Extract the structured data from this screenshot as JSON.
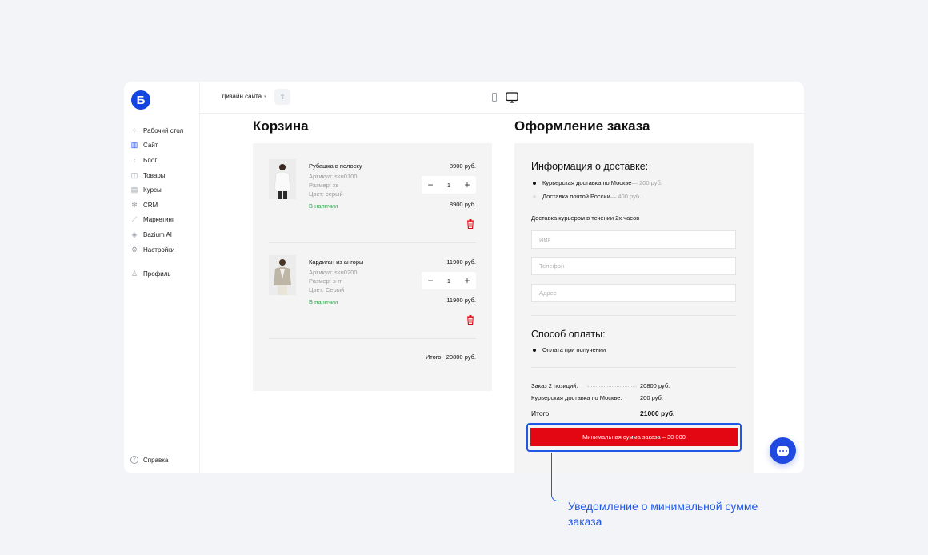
{
  "sidebar": {
    "logo": "Б",
    "items": [
      {
        "label": "Рабочий стол",
        "icon": "grid-icon",
        "glyph": "⁘"
      },
      {
        "label": "Сайт",
        "icon": "layout-icon",
        "glyph": "▥"
      },
      {
        "label": "Блог",
        "icon": "chevron-left-icon",
        "glyph": "‹"
      },
      {
        "label": "Товары",
        "icon": "bag-icon",
        "glyph": "◫"
      },
      {
        "label": "Курсы",
        "icon": "book-icon",
        "glyph": "▤"
      },
      {
        "label": "CRM",
        "icon": "snowflake-icon",
        "glyph": "✻"
      },
      {
        "label": "Маркетинг",
        "icon": "chart-icon",
        "glyph": "⟋"
      },
      {
        "label": "Bazium AI",
        "icon": "ai-icon",
        "glyph": "◈"
      },
      {
        "label": "Настройки",
        "icon": "gear-icon",
        "glyph": "⚙"
      }
    ],
    "profile": {
      "label": "Профиль",
      "icon": "user-icon",
      "glyph": "♙"
    },
    "help": {
      "label": "Справка",
      "glyph": "?"
    }
  },
  "topbar": {
    "site": "Дизайн сайта",
    "caret": "▾",
    "share_glyph": "⇪"
  },
  "cart": {
    "title": "Корзина",
    "products": [
      {
        "name": "Рубашка в полоску",
        "article": "Артикул: sku0100",
        "size": "Размер: xs",
        "color": "Цвет: серый",
        "stock": "В наличии",
        "price": "8900 руб.",
        "qty": "1",
        "subtotal": "8900 руб."
      },
      {
        "name": "Кардиган из ангоры",
        "article": "Артикул: sku0200",
        "size": "Размер: s-m",
        "color": "Цвет: Серый",
        "stock": "В наличии",
        "price": "11900 руб.",
        "qty": "1",
        "subtotal": "11900 руб."
      }
    ],
    "minus": "−",
    "plus": "+",
    "total_label": "Итого:",
    "total_value": "20800 руб."
  },
  "checkout": {
    "title": "Оформление заказа",
    "delivery_heading": "Информация о доставке:",
    "delivery_options": [
      {
        "label": "Курьерская доставка по Москве",
        "extra": " — 200 руб.",
        "selected": true
      },
      {
        "label": "Доставка почтой России",
        "extra": " — 400 руб.",
        "selected": false
      }
    ],
    "delivery_note": "Доставка курьером в течении 2х часов",
    "fields": {
      "name_placeholder": "Имя",
      "phone_placeholder": "Телефон",
      "address_placeholder": "Адрес"
    },
    "payment_heading": "Способ оплаты:",
    "payment_option": "Оплата при получении",
    "summary": {
      "order_label": "Заказ 2 позиций:",
      "order_value": "20800 руб.",
      "delivery_label": "Курьерская доставка по Москве:",
      "delivery_value": "200 руб.",
      "total_label": "Итого:",
      "total_value": "21000 руб."
    },
    "min_sum_button": "Минимальная сумма заказа – 30 000"
  },
  "annotation": {
    "text": "Уведомление о минимальной сумме заказа"
  },
  "colors": {
    "accent": "#1f58e6",
    "danger": "#e30613",
    "stock": "#2fa84f"
  }
}
